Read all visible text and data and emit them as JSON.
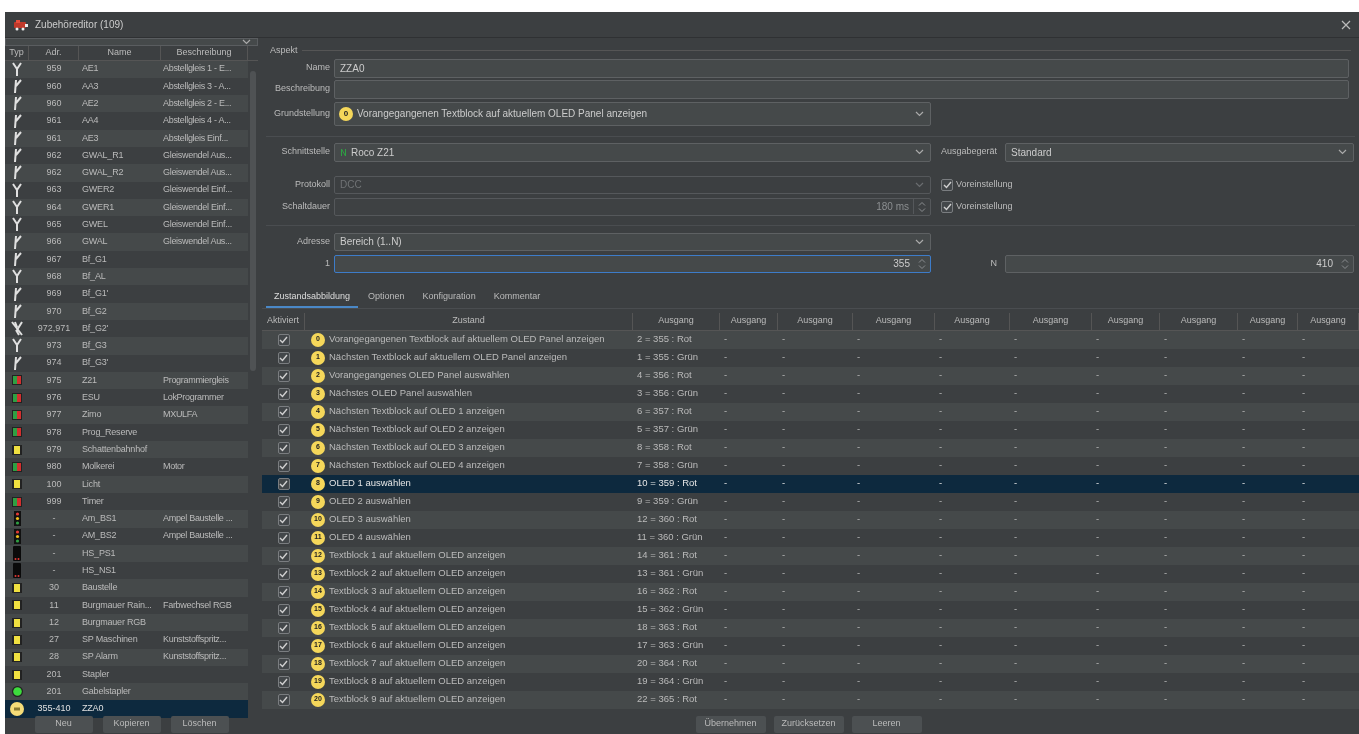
{
  "window": {
    "title": "Zubehöreditor (109)"
  },
  "accessory_list": {
    "columns": [
      "Typ",
      "Adr.",
      "Name",
      "Beschreibung"
    ],
    "rows": [
      {
        "kind": "turnout_y",
        "address": "959",
        "name": "AE1",
        "description": "Abstellgleis 1 - E...",
        "selected": false
      },
      {
        "kind": "turnout_right",
        "address": "960",
        "name": "AA3",
        "description": "Abstellgleis 3 - A...",
        "selected": false
      },
      {
        "kind": "turnout_right",
        "address": "960",
        "name": "AE2",
        "description": "Abstellgleis 2 - E...",
        "selected": false
      },
      {
        "kind": "turnout_right",
        "address": "961",
        "name": "AA4",
        "description": "Abstellgleis 4 - A...",
        "selected": false
      },
      {
        "kind": "turnout_right",
        "address": "961",
        "name": "AE3",
        "description": "Abstellgleis Einf...",
        "selected": false
      },
      {
        "kind": "turnout_right",
        "address": "962",
        "name": "GWAL_R1",
        "description": "Gleiswendel Aus...",
        "selected": false
      },
      {
        "kind": "turnout_right",
        "address": "962",
        "name": "GWAL_R2",
        "description": "Gleiswendel Aus...",
        "selected": false
      },
      {
        "kind": "turnout_y",
        "address": "963",
        "name": "GWER2",
        "description": "Gleiswendel Einf...",
        "selected": false
      },
      {
        "kind": "turnout_y",
        "address": "964",
        "name": "GWER1",
        "description": "Gleiswendel Einf...",
        "selected": false
      },
      {
        "kind": "turnout_y",
        "address": "965",
        "name": "GWEL",
        "description": "Gleiswendel Einf...",
        "selected": false
      },
      {
        "kind": "turnout_right",
        "address": "966",
        "name": "GWAL",
        "description": "Gleiswendel Aus...",
        "selected": false
      },
      {
        "kind": "turnout_right",
        "address": "967",
        "name": "Bf_G1",
        "selected": false
      },
      {
        "kind": "turnout_y",
        "address": "968",
        "name": "Bf_AL",
        "selected": false
      },
      {
        "kind": "turnout_right",
        "address": "969",
        "name": "Bf_G1'",
        "selected": false
      },
      {
        "kind": "turnout_right",
        "address": "970",
        "name": "Bf_G2",
        "selected": false
      },
      {
        "kind": "double_slip",
        "address": "972,971",
        "name": "Bf_G2'",
        "selected": false
      },
      {
        "kind": "turnout_y",
        "address": "973",
        "name": "Bf_G3",
        "selected": false
      },
      {
        "kind": "turnout_right",
        "address": "974",
        "name": "Bf_G3'",
        "selected": false
      },
      {
        "kind": "relay",
        "address": "975",
        "name": "Z21",
        "description": "Programmiergleis",
        "selected": false
      },
      {
        "kind": "relay",
        "address": "976",
        "name": "ESU",
        "description": "LokProgrammer",
        "selected": false
      },
      {
        "kind": "relay",
        "address": "977",
        "name": "Zimo",
        "description": "MXULFA",
        "selected": false
      },
      {
        "kind": "relay",
        "address": "978",
        "name": "Prog_Reserve",
        "selected": false
      },
      {
        "kind": "light",
        "address": "979",
        "name": "Schattenbahnhof",
        "selected": false
      },
      {
        "kind": "relay",
        "address": "980",
        "name": "Molkerei",
        "description": "Motor",
        "selected": false
      },
      {
        "kind": "light",
        "address": "100",
        "name": "Licht",
        "selected": false
      },
      {
        "kind": "relay",
        "address": "999",
        "name": "Timer",
        "selected": false
      },
      {
        "kind": "traffic_light",
        "address": "-",
        "name": "Am_BS1",
        "description": "Ampel Baustelle ...",
        "selected": false
      },
      {
        "kind": "traffic_light",
        "address": "-",
        "name": "AM_BS2",
        "description": "Ampel Baustelle ...",
        "selected": false
      },
      {
        "kind": "signal",
        "address": "-",
        "name": "HS_PS1",
        "selected": false
      },
      {
        "kind": "signal",
        "address": "-",
        "name": "HS_NS1",
        "selected": false
      },
      {
        "kind": "light",
        "address": "30",
        "name": "Baustelle",
        "selected": false
      },
      {
        "kind": "light",
        "address": "11",
        "name": "Burgmauer Rain...",
        "description": "Farbwechsel RGB",
        "selected": false
      },
      {
        "kind": "light",
        "address": "12",
        "name": "Burgmauer RGB",
        "selected": false
      },
      {
        "kind": "light",
        "address": "27",
        "name": "SP Maschinen",
        "description": "Kunststoffspritz...",
        "selected": false
      },
      {
        "kind": "light",
        "address": "28",
        "name": "SP Alarm",
        "description": "Kunststoffspritz...",
        "selected": false
      },
      {
        "kind": "light",
        "address": "201",
        "name": "Stapler",
        "selected": false
      },
      {
        "kind": "round_light",
        "address": "201",
        "name": "Gabelstapler",
        "selected": false
      },
      {
        "kind": "display",
        "address": "355-410",
        "name": "ZZA0",
        "selected": true
      }
    ]
  },
  "list_buttons": [
    "Neu",
    "Kopieren",
    "Löschen"
  ],
  "aspect": {
    "title": "Aspekt",
    "name_label": "Name",
    "name_value": "ZZA0",
    "description_label": "Beschreibung",
    "default_label": "Grundstellung",
    "default_badge": "0",
    "default_value": "Vorangegangenen Textblock auf aktuellem OLED Panel anzeigen"
  },
  "connection": {
    "interface_label": "Schnittstelle",
    "interface_value": "Roco Z21",
    "output_device_label": "Ausgabegerät",
    "output_device_value": "Standard",
    "protocol_label": "Protokoll",
    "protocol_value": "DCC",
    "protocol_disabled": true,
    "protocol_default": {
      "label": "Voreinstellung",
      "checked": true
    },
    "duration_label": "Schaltdauer",
    "duration_value": "180 ms",
    "duration_default": {
      "label": "Voreinstellung",
      "checked": true
    }
  },
  "address": {
    "label": "Adresse",
    "mode": "Bereich (1..N)",
    "from_label": "1",
    "from_value": "355",
    "from_focused": true,
    "to_label": "N",
    "to_value": "410"
  },
  "tabs": [
    {
      "label": "Zustandsabbildung",
      "selected": true
    },
    {
      "label": "Optionen",
      "selected": false
    },
    {
      "label": "Konfiguration",
      "selected": false
    },
    {
      "label": "Kommentar",
      "selected": false
    }
  ],
  "state_table": {
    "columns": [
      "Aktiviert",
      "Zustand",
      "Ausgang",
      "Ausgang",
      "Ausgang",
      "Ausgang",
      "Ausgang",
      "Ausgang",
      "Ausgang",
      "Ausgang",
      "Ausgang",
      "Ausgang"
    ],
    "rows": [
      {
        "checked": true,
        "badge": "0",
        "state": "Vorangegangenen Textblock auf aktuellem OLED Panel anzeigen",
        "outputs": [
          "2 = 355 : Rot",
          "-",
          "-",
          "-",
          "-",
          "-",
          "-",
          "-",
          "-",
          "-"
        ],
        "selected": false
      },
      {
        "checked": true,
        "badge": "1",
        "state": "Nächsten Textblock auf aktuellem OLED Panel anzeigen",
        "outputs": [
          "1 = 355 : Grün",
          "-",
          "-",
          "-",
          "-",
          "-",
          "-",
          "-",
          "-",
          "-"
        ],
        "selected": false
      },
      {
        "checked": true,
        "badge": "2",
        "state": "Vorangegangenes OLED Panel auswählen",
        "outputs": [
          "4 = 356 : Rot",
          "-",
          "-",
          "-",
          "-",
          "-",
          "-",
          "-",
          "-",
          "-"
        ],
        "selected": false
      },
      {
        "checked": true,
        "badge": "3",
        "state": "Nächstes OLED Panel auswählen",
        "outputs": [
          "3 = 356 : Grün",
          "-",
          "-",
          "-",
          "-",
          "-",
          "-",
          "-",
          "-",
          "-"
        ],
        "selected": false
      },
      {
        "checked": true,
        "badge": "4",
        "state": "Nächsten Textblock auf OLED 1 anzeigen",
        "outputs": [
          "6 = 357 : Rot",
          "-",
          "-",
          "-",
          "-",
          "-",
          "-",
          "-",
          "-",
          "-"
        ],
        "selected": false
      },
      {
        "checked": true,
        "badge": "5",
        "state": "Nächsten Textblock auf OLED 2 anzeigen",
        "outputs": [
          "5 = 357 : Grün",
          "-",
          "-",
          "-",
          "-",
          "-",
          "-",
          "-",
          "-",
          "-"
        ],
        "selected": false
      },
      {
        "checked": true,
        "badge": "6",
        "state": "Nächsten Textblock auf OLED 3 anzeigen",
        "outputs": [
          "8 = 358 : Rot",
          "-",
          "-",
          "-",
          "-",
          "-",
          "-",
          "-",
          "-",
          "-"
        ],
        "selected": false
      },
      {
        "checked": true,
        "badge": "7",
        "state": "Nächsten Textblock auf OLED 4 anzeigen",
        "outputs": [
          "7 = 358 : Grün",
          "-",
          "-",
          "-",
          "-",
          "-",
          "-",
          "-",
          "-",
          "-"
        ],
        "selected": false
      },
      {
        "checked": true,
        "badge": "8",
        "state": "OLED 1 auswählen",
        "outputs": [
          "10 = 359 : Rot",
          "-",
          "-",
          "-",
          "-",
          "-",
          "-",
          "-",
          "-",
          "-"
        ],
        "selected": true
      },
      {
        "checked": true,
        "badge": "9",
        "state": "OLED 2 auswählen",
        "outputs": [
          "9 = 359 : Grün",
          "-",
          "-",
          "-",
          "-",
          "-",
          "-",
          "-",
          "-",
          "-"
        ],
        "selected": false
      },
      {
        "checked": true,
        "badge": "10",
        "state": "OLED 3 auswählen",
        "outputs": [
          "12 = 360 : Rot",
          "-",
          "-",
          "-",
          "-",
          "-",
          "-",
          "-",
          "-",
          "-"
        ],
        "selected": false
      },
      {
        "checked": true,
        "badge": "11",
        "state": "OLED 4 auswählen",
        "outputs": [
          "11 = 360 : Grün",
          "-",
          "-",
          "-",
          "-",
          "-",
          "-",
          "-",
          "-",
          "-"
        ],
        "selected": false
      },
      {
        "checked": true,
        "badge": "12",
        "state": "Textblock 1 auf aktuellem OLED anzeigen",
        "outputs": [
          "14 = 361 : Rot",
          "-",
          "-",
          "-",
          "-",
          "-",
          "-",
          "-",
          "-",
          "-"
        ],
        "selected": false
      },
      {
        "checked": true,
        "badge": "13",
        "state": "Textblock 2 auf aktuellem OLED anzeigen",
        "outputs": [
          "13 = 361 : Grün",
          "-",
          "-",
          "-",
          "-",
          "-",
          "-",
          "-",
          "-",
          "-"
        ],
        "selected": false
      },
      {
        "checked": true,
        "badge": "14",
        "state": "Textblock 3 auf aktuellem OLED anzeigen",
        "outputs": [
          "16 = 362 : Rot",
          "-",
          "-",
          "-",
          "-",
          "-",
          "-",
          "-",
          "-",
          "-"
        ],
        "selected": false
      },
      {
        "checked": true,
        "badge": "15",
        "state": "Textblock 4 auf aktuellem OLED anzeigen",
        "outputs": [
          "15 = 362 : Grün",
          "-",
          "-",
          "-",
          "-",
          "-",
          "-",
          "-",
          "-",
          "-"
        ],
        "selected": false
      },
      {
        "checked": true,
        "badge": "16",
        "state": "Textblock 5 auf aktuellem OLED anzeigen",
        "outputs": [
          "18 = 363 : Rot",
          "-",
          "-",
          "-",
          "-",
          "-",
          "-",
          "-",
          "-",
          "-"
        ],
        "selected": false
      },
      {
        "checked": true,
        "badge": "17",
        "state": "Textblock 6 auf aktuellem OLED anzeigen",
        "outputs": [
          "17 = 363 : Grün",
          "-",
          "-",
          "-",
          "-",
          "-",
          "-",
          "-",
          "-",
          "-"
        ],
        "selected": false
      },
      {
        "checked": true,
        "badge": "18",
        "state": "Textblock 7 auf aktuellem OLED anzeigen",
        "outputs": [
          "20 = 364 : Rot",
          "-",
          "-",
          "-",
          "-",
          "-",
          "-",
          "-",
          "-",
          "-"
        ],
        "selected": false
      },
      {
        "checked": true,
        "badge": "19",
        "state": "Textblock 8 auf aktuellem OLED anzeigen",
        "outputs": [
          "19 = 364 : Grün",
          "-",
          "-",
          "-",
          "-",
          "-",
          "-",
          "-",
          "-",
          "-"
        ],
        "selected": false
      },
      {
        "checked": true,
        "badge": "20",
        "state": "Textblock 9 auf aktuellem OLED anzeigen",
        "outputs": [
          "22 = 365 : Rot",
          "-",
          "-",
          "-",
          "-",
          "-",
          "-",
          "-",
          "-",
          "-"
        ],
        "selected": false
      }
    ]
  },
  "editor_buttons": [
    "Übernehmen",
    "Zurücksetzen",
    "Leeren"
  ]
}
